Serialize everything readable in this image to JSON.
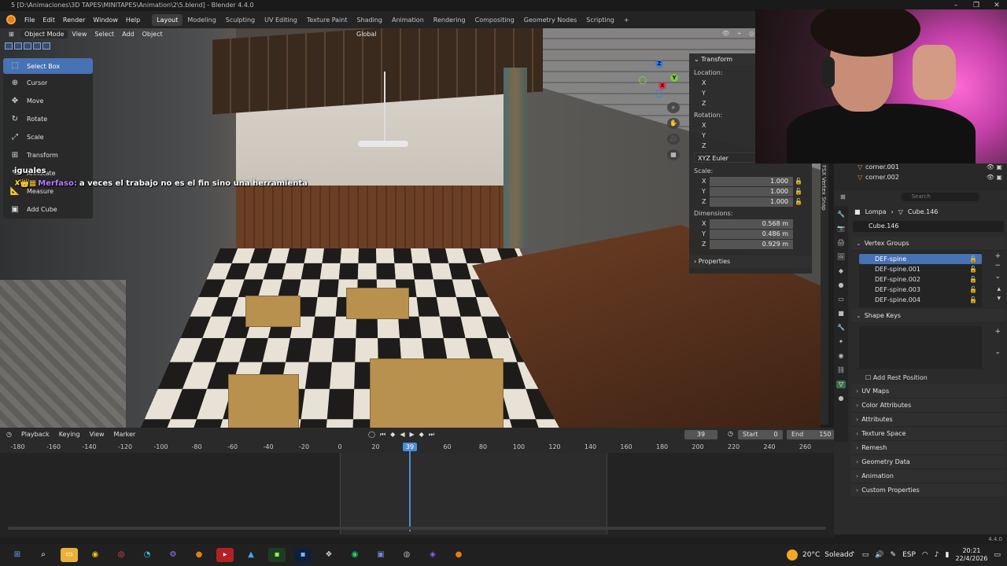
{
  "titlebar": {
    "text": "5 [D:\\Animaciones\\3D TAPES\\MINITAPES\\Animation\\2\\5.blend] - Blender 4.4.0"
  },
  "menu": [
    "File",
    "Edit",
    "Render",
    "Window",
    "Help"
  ],
  "workspaces": [
    "Layout",
    "Modeling",
    "Sculpting",
    "UV Editing",
    "Texture Paint",
    "Shading",
    "Animation",
    "Rendering",
    "Compositing",
    "Geometry Nodes",
    "Scripting"
  ],
  "viewport_header": {
    "mode": "Object Mode",
    "view": "View",
    "select": "Select",
    "add": "Add",
    "object": "Object",
    "orientation": "Global"
  },
  "tools": [
    {
      "label": "Select Box",
      "icon": "select-box-icon",
      "glyph": "⬚"
    },
    {
      "label": "Cursor",
      "icon": "cursor-icon",
      "glyph": "⊕"
    },
    {
      "label": "Move",
      "icon": "move-icon",
      "glyph": "✥"
    },
    {
      "label": "Rotate",
      "icon": "rotate-icon",
      "glyph": "↻"
    },
    {
      "label": "Scale",
      "icon": "scale-icon",
      "glyph": "⤢"
    },
    {
      "label": "Transform",
      "icon": "transform-icon",
      "glyph": "⊞"
    },
    {
      "label": "Annotate",
      "icon": "annotate-icon",
      "glyph": "✎"
    },
    {
      "label": "Measure",
      "icon": "measure-icon",
      "glyph": "📐"
    },
    {
      "label": "Add Cube",
      "icon": "add-cube-icon",
      "glyph": "▣"
    }
  ],
  "chat": {
    "previous": "iguales",
    "user": "Merfaso:",
    "message": "a veces el trabajo no es el fin sino una herramienta"
  },
  "transform_panel": {
    "title": "Transform",
    "location_label": "Location:",
    "rotation_label": "Rotation:",
    "rotation_mode": "XYZ Euler",
    "scale_label": "Scale:",
    "scale": {
      "x": "1.000",
      "y": "1.000",
      "z": "1.000"
    },
    "dimensions_label": "Dimensions:",
    "dimensions": {
      "x": "0.568 m",
      "y": "0.486 m",
      "z": "0.929 m"
    },
    "properties_label": "Properties",
    "axes": {
      "x": "X",
      "y": "Y",
      "z": "Z"
    }
  },
  "side_tab": "FSX Vertex Snap",
  "outliner": {
    "rows": [
      "corner.001",
      "corner.002"
    ]
  },
  "properties": {
    "search_placeholder": "Search",
    "object": "Lompa",
    "mesh": "Cube.146",
    "mesh_field": "Cube.146",
    "vertex_groups_title": "Vertex Groups",
    "vertex_groups": [
      "DEF-spine",
      "DEF-spine.001",
      "DEF-spine.002",
      "DEF-spine.003",
      "DEF-spine.004"
    ],
    "shape_keys_title": "Shape Keys",
    "add_rest_position": "Add Rest Position",
    "sections": [
      "UV Maps",
      "Color Attributes",
      "Attributes",
      "Texture Space",
      "Remesh",
      "Geometry Data",
      "Animation",
      "Custom Properties"
    ]
  },
  "timeline": {
    "playback": "Playback",
    "keying": "Keying",
    "view": "View",
    "marker": "Marker",
    "current_frame": "39",
    "start_label": "Start",
    "start": "0",
    "end_label": "End",
    "end": "150",
    "ticks": [
      "-180",
      "-160",
      "-140",
      "-120",
      "-100",
      "-80",
      "-60",
      "-40",
      "-20",
      "0",
      "20",
      "40",
      "60",
      "80",
      "100",
      "120",
      "140",
      "160",
      "180",
      "200",
      "220",
      "240",
      "260"
    ]
  },
  "version": "4.4.0",
  "taskbar": {
    "weather_temp": "20°C",
    "weather_text": "Soleado",
    "weather_badge": "2",
    "lang": "ESP",
    "time": "20:21",
    "date": "22/4/2026"
  },
  "colors": {
    "accent": "#4772b3",
    "blender_orange": "#e87d0d",
    "playhead": "#4d8cd8"
  }
}
